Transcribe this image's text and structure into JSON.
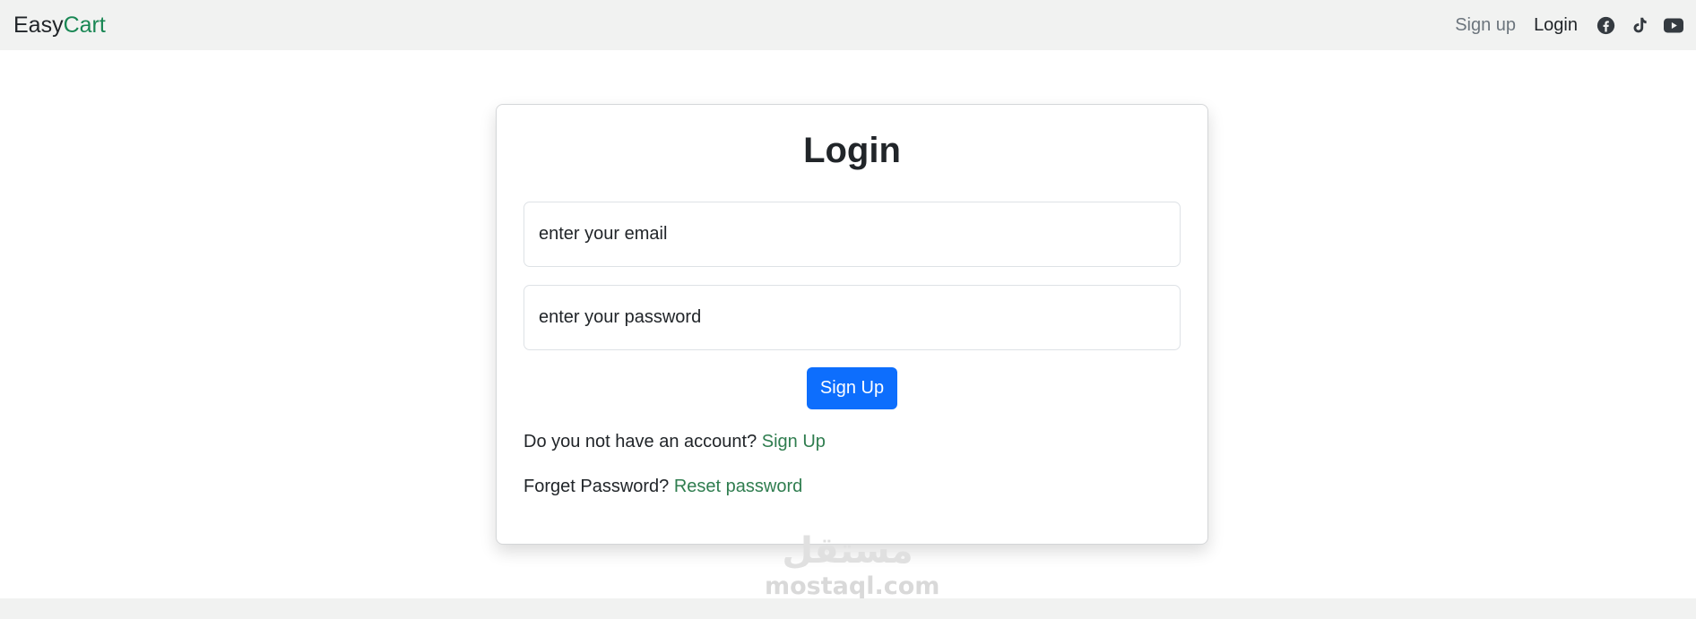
{
  "navbar": {
    "brand_part1": "Easy",
    "brand_part2": "Cart",
    "brand_color": "#198754",
    "links": [
      {
        "label": "Sign up",
        "state": "muted"
      },
      {
        "label": "Login",
        "state": "active"
      }
    ],
    "social_icons": [
      "facebook-icon",
      "tiktok-icon",
      "youtube-icon"
    ]
  },
  "login_card": {
    "title": "Login",
    "email_placeholder": "enter your email",
    "password_placeholder": "enter your password",
    "submit_label": "Sign Up",
    "submit_color": "#0d6efd",
    "signup_prompt": "Do you not have an account?",
    "signup_link": "Sign Up",
    "forgot_prompt": "Forget Password?",
    "reset_link": "Reset password",
    "link_color": "#2f7d4f"
  },
  "watermark": {
    "arabic": "مستقل",
    "latin": "mostaql.com"
  }
}
